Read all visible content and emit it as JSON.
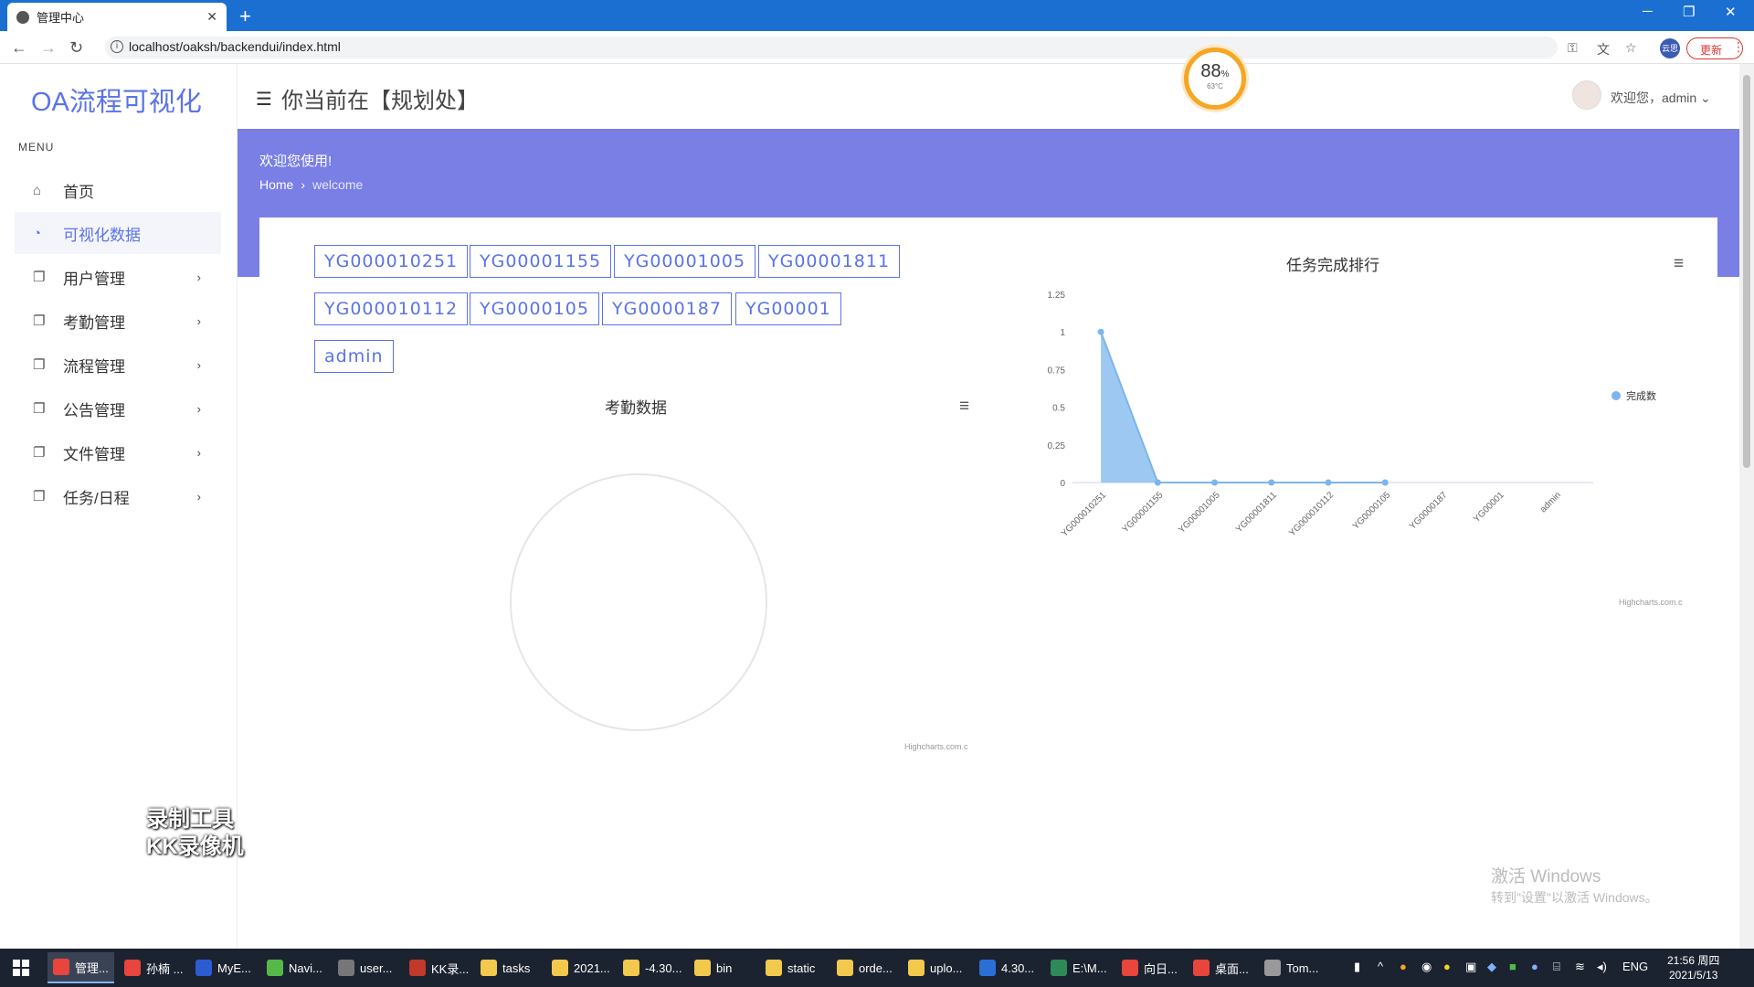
{
  "browser": {
    "tab_title": "管理中心",
    "url": "localhost/oaksh/backendui/index.html",
    "update_label": "更新",
    "profile_label": "云思"
  },
  "app": {
    "brand": "OA流程可视化",
    "menu_title": "MENU",
    "location": "你当前在【规划处】",
    "user_welcome": "欢迎您，admin",
    "sidebar": [
      {
        "label": "首页",
        "icon": "home-icon"
      },
      {
        "label": "可视化数据",
        "icon": "chart-icon"
      },
      {
        "label": "用户管理",
        "icon": "copy-icon"
      },
      {
        "label": "考勤管理",
        "icon": "copy-icon"
      },
      {
        "label": "流程管理",
        "icon": "copy-icon"
      },
      {
        "label": "公告管理",
        "icon": "copy-icon"
      },
      {
        "label": "文件管理",
        "icon": "copy-icon"
      },
      {
        "label": "任务/日程",
        "icon": "copy-icon"
      }
    ],
    "hero": {
      "title": "欢迎您使用!",
      "crumb_home": "Home",
      "crumb_current": "welcome"
    },
    "gauge": {
      "percent": "88",
      "unit": "%",
      "temp": "63°C"
    },
    "tags": [
      "YG000010251",
      "YG00001155",
      "YG00001005",
      "YG00001811",
      "YG000010112",
      "YG0000105",
      "YG0000187",
      "YG00001",
      "admin"
    ],
    "attendance_chart": {
      "title": "考勤数据",
      "credit": "Highcharts.com.c"
    },
    "colors": {
      "accent": "#5b73e8",
      "hero": "#7a7fe6",
      "series": "#7cb5ec"
    }
  },
  "chart_data": {
    "type": "area",
    "title": "任务完成排行",
    "categories": [
      "YG000010251",
      "YG00001155",
      "YG00001005",
      "YG00001811",
      "YG000010112",
      "YG0000105",
      "YG0000187",
      "YG00001",
      "admin"
    ],
    "series": [
      {
        "name": "完成数",
        "values": [
          1,
          0,
          0,
          0,
          0,
          0,
          null,
          null,
          null
        ]
      }
    ],
    "yticks": [
      "0",
      "0.25",
      "0.5",
      "0.75",
      "1",
      "1.25"
    ],
    "ylim": [
      0,
      1.25
    ],
    "legend": "right",
    "credit": "Highcharts.com.c"
  },
  "watermark": {
    "line1": "录制工具",
    "line2": "KK录像机"
  },
  "windows": {
    "line1": "激活 Windows",
    "line2": "转到\"设置\"以激活 Windows。"
  },
  "taskbar": {
    "items": [
      {
        "label": "管理...",
        "color": "#e8453c"
      },
      {
        "label": "孙楠 ...",
        "color": "#e8453c"
      },
      {
        "label": "MyE...",
        "color": "#2d5bd1"
      },
      {
        "label": "Navi...",
        "color": "#55b948"
      },
      {
        "label": "user...",
        "color": "#777777"
      },
      {
        "label": "KK录...",
        "color": "#c0392b"
      },
      {
        "label": "tasks",
        "color": "#f2c94c"
      },
      {
        "label": "2021...",
        "color": "#f2c94c"
      },
      {
        "label": "-4.30...",
        "color": "#f2c94c"
      },
      {
        "label": "bin",
        "color": "#f2c94c"
      },
      {
        "label": "static",
        "color": "#f2c94c"
      },
      {
        "label": "orde...",
        "color": "#f2c94c"
      },
      {
        "label": "uplo...",
        "color": "#f2c94c"
      },
      {
        "label": "4.30...",
        "color": "#2b6fd6"
      },
      {
        "label": "E:\\M...",
        "color": "#2e8b57"
      },
      {
        "label": "向日...",
        "color": "#e8453c"
      },
      {
        "label": "桌面...",
        "color": "#e8453c"
      },
      {
        "label": "Tom...",
        "color": "#999999"
      }
    ],
    "lang": "ENG",
    "time": "21:56 周四",
    "date": "2021/5/13"
  }
}
